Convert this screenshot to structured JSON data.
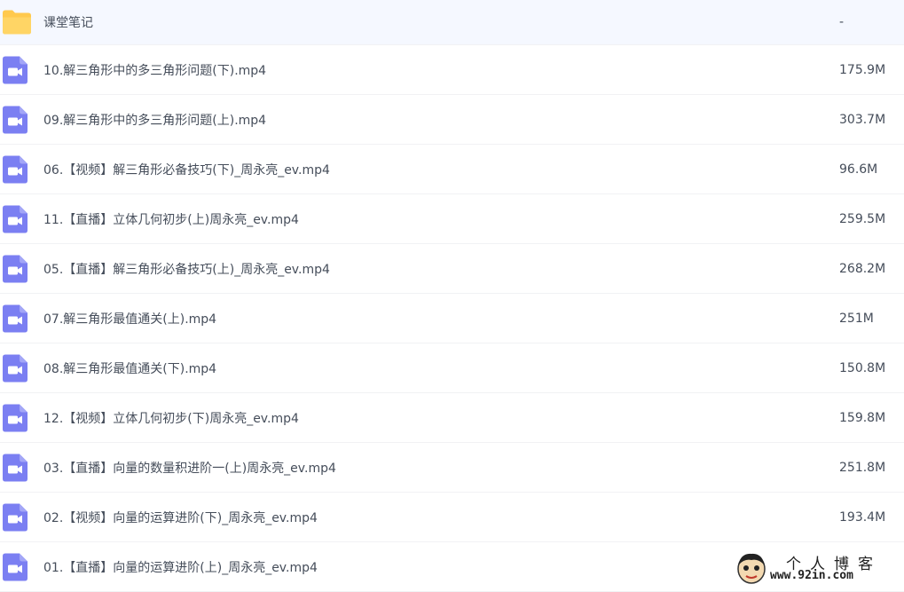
{
  "files": [
    {
      "name": "课堂笔记",
      "size": "-",
      "icon": "folder-icon"
    },
    {
      "name": "10.解三角形中的多三角形问题(下).mp4",
      "size": "175.9M",
      "icon": "video-file-icon"
    },
    {
      "name": "09.解三角形中的多三角形问题(上).mp4",
      "size": "303.7M",
      "icon": "video-file-icon"
    },
    {
      "name": "06.【视频】解三角形必备技巧(下)_周永亮_ev.mp4",
      "size": "96.6M",
      "icon": "video-file-icon"
    },
    {
      "name": "11.【直播】立体几何初步(上)周永亮_ev.mp4",
      "size": "259.5M",
      "icon": "video-file-icon"
    },
    {
      "name": "05.【直播】解三角形必备技巧(上)_周永亮_ev.mp4",
      "size": "268.2M",
      "icon": "video-file-icon"
    },
    {
      "name": "07.解三角形最值通关(上).mp4",
      "size": "251M",
      "icon": "video-file-icon"
    },
    {
      "name": "08.解三角形最值通关(下).mp4",
      "size": "150.8M",
      "icon": "video-file-icon"
    },
    {
      "name": "12.【视频】立体几何初步(下)周永亮_ev.mp4",
      "size": "159.8M",
      "icon": "video-file-icon"
    },
    {
      "name": "03.【直播】向量的数量积进阶一(上)周永亮_ev.mp4",
      "size": "251.8M",
      "icon": "video-file-icon"
    },
    {
      "name": "02.【视频】向量的运算进阶(下)_周永亮_ev.mp4",
      "size": "193.4M",
      "icon": "video-file-icon"
    },
    {
      "name": "01.【直播】向量的运算进阶(上)_周永亮_ev.mp4",
      "size": "",
      "icon": "video-file-icon"
    }
  ],
  "watermark": {
    "title": "个人博客",
    "url": "www.92in.com"
  },
  "colors": {
    "folder": "#ffc94d",
    "video": "#7b7ff2",
    "text": "#454d5a",
    "divider": "#f1f2f4"
  }
}
